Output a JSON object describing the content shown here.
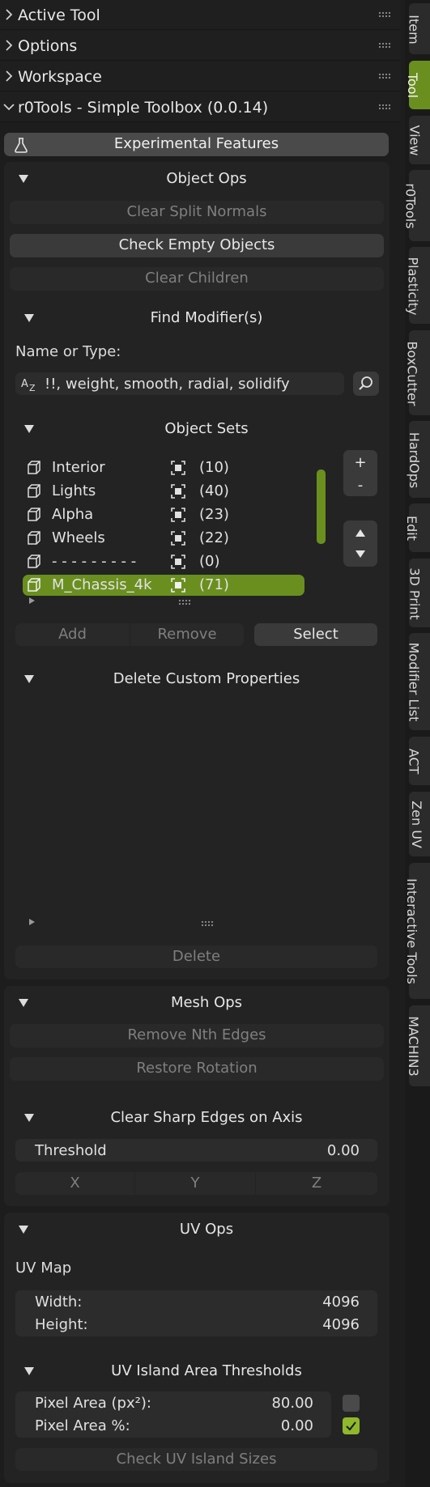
{
  "headers": [
    {
      "label": "Active Tool",
      "expanded": false
    },
    {
      "label": "Options",
      "expanded": false
    },
    {
      "label": "Workspace",
      "expanded": false
    },
    {
      "label": "r0Tools - Simple Toolbox (0.0.14)",
      "expanded": true
    }
  ],
  "experimental_label": "Experimental Features",
  "object_ops": {
    "title": "Object Ops",
    "buttons": [
      "Clear Split Normals",
      "Check Empty Objects",
      "Clear Children"
    ],
    "find_modifier": {
      "title": "Find Modifier(s)",
      "name_label": "Name or Type:",
      "search_value": "!!, weight, smooth, radial, solidify"
    },
    "object_sets": {
      "title": "Object Sets",
      "rows": [
        {
          "name": "Interior",
          "count": "(10)"
        },
        {
          "name": "Lights",
          "count": "(40)"
        },
        {
          "name": "Alpha",
          "count": "(23)"
        },
        {
          "name": "Wheels",
          "count": "(22)"
        },
        {
          "name": "- - - - - - - - -",
          "count": "(0)"
        },
        {
          "name": "M_Chassis_4k",
          "count": "(71)"
        }
      ],
      "add_label": "+",
      "remove_label": "-",
      "actions": [
        "Add",
        "Remove",
        "Select"
      ]
    },
    "delete_custom": {
      "title": "Delete Custom Properties",
      "delete_label": "Delete"
    }
  },
  "mesh_ops": {
    "title": "Mesh Ops",
    "buttons": [
      "Remove Nth Edges",
      "Restore Rotation"
    ],
    "clear_sharp": {
      "title": "Clear Sharp Edges on Axis",
      "threshold_label": "Threshold",
      "threshold_value": "0.00",
      "axes": [
        "X",
        "Y",
        "Z"
      ]
    }
  },
  "uv_ops": {
    "title": "UV Ops",
    "uv_map_label": "UV Map",
    "width_label": "Width:",
    "width_value": "4096",
    "height_label": "Height:",
    "height_value": "4096",
    "island": {
      "title": "UV Island Area Thresholds",
      "px_label": "Pixel Area (px²):",
      "px_value": "80.00",
      "px_checked": false,
      "pct_label": "Pixel Area %:",
      "pct_value": "0.00",
      "pct_checked": true,
      "check_label": "Check UV Island Sizes"
    }
  },
  "side_tabs": [
    "Item",
    "Tool",
    "View",
    "r0Tools",
    "Plasticity",
    "BoxCutter",
    "HardOps",
    "Edit",
    "3D Print",
    "Modifier List",
    "ACT",
    "Zen UV",
    "Interactive Tools",
    "MACHIN3"
  ],
  "active_tab": "Tool",
  "colors": {
    "accent": "#6a8f1f",
    "check": "#8fb82c"
  }
}
